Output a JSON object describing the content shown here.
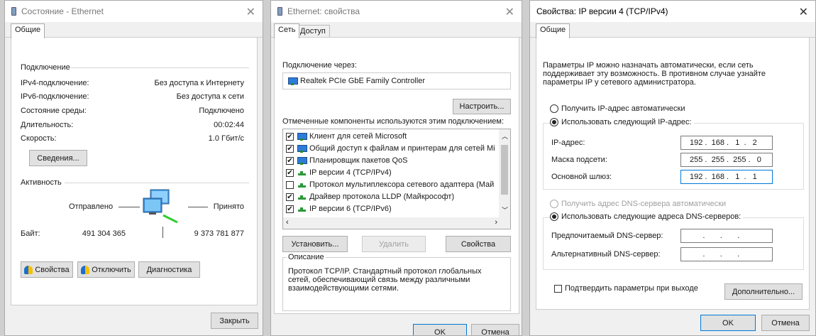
{
  "status": {
    "title": "Состояние - Ethernet",
    "tab_general": "Общие",
    "conn_header": "Подключение",
    "rows": [
      {
        "label": "IPv4-подключение:",
        "value": "Без доступа к Интернету"
      },
      {
        "label": "IPv6-подключение:",
        "value": "Без доступа к сети"
      },
      {
        "label": "Состояние среды:",
        "value": "Подключено"
      },
      {
        "label": "Длительность:",
        "value": "00:02:44"
      },
      {
        "label": "Скорость:",
        "value": "1.0 Гбит/с"
      }
    ],
    "details_button": "Сведения...",
    "activity_header": "Активность",
    "sent_label": "Отправлено",
    "received_label": "Принято",
    "bytes_label": "Байт:",
    "bytes_sent": "491 304 365",
    "bytes_received": "9 373 781 877",
    "properties_button": "Свойства",
    "disable_button": "Отключить",
    "diagnose_button": "Диагностика",
    "close_button": "Закрыть"
  },
  "ethprops": {
    "title": "Ethernet: свойства",
    "tab_network": "Сеть",
    "tab_access": "Доступ",
    "connect_using": "Подключение через:",
    "adapter": "Realtek PCIe GbE Family Controller",
    "configure_button": "Настроить...",
    "components_label": "Отмеченные компоненты используются этим подключением:",
    "components": [
      {
        "checked": "✔",
        "icon": "net",
        "label": "Клиент для сетей Microsoft"
      },
      {
        "checked": "✔",
        "icon": "net",
        "label": "Общий доступ к файлам и принтерам для сетей Mi"
      },
      {
        "checked": "✔",
        "icon": "net",
        "label": "Планировщик пакетов QoS"
      },
      {
        "checked": "✔",
        "icon": "proto",
        "label": "IP версии 4 (TCP/IPv4)"
      },
      {
        "checked": "",
        "icon": "proto",
        "label": "Протокол мультиплексора сетевого адаптера (Май"
      },
      {
        "checked": "✔",
        "icon": "proto",
        "label": "Драйвер протокола LLDP (Майкрософт)"
      },
      {
        "checked": "✔",
        "icon": "proto",
        "label": "IP версии 6 (TCP/IPv6)"
      }
    ],
    "install_button": "Установить...",
    "uninstall_button": "Удалить",
    "properties_button": "Свойства",
    "description_header": "Описание",
    "description": "Протокол TCP/IP. Стандартный протокол глобальных сетей, обеспечивающий связь между различными взаимодействующими сетями.",
    "ok_button": "OK",
    "cancel_button": "Отмена"
  },
  "ipv4": {
    "title": "Свойства: IP версии 4 (TCP/IPv4)",
    "tab_general": "Общие",
    "intro": "Параметры IP можно назначать автоматически, если сеть поддерживает эту возможность. В противном случае узнайте параметры IP у сетевого администратора.",
    "auto_ip": "Получить IP-адрес автоматически",
    "manual_ip": "Использовать следующий IP-адрес:",
    "ip_label": "IP-адрес:",
    "ip_value": "192 .  168 .   1  .   2",
    "mask_label": "Маска подсети:",
    "mask_value": "255 .  255 .  255 .   0",
    "gateway_label": "Основной шлюз:",
    "gateway_value": "192 .  168 .   1  .   1",
    "auto_dns": "Получить адрес DNS-сервера автоматически",
    "manual_dns": "Использовать следующие адреса DNS-серверов:",
    "pref_dns_label": "Предпочитаемый DNS-сервер:",
    "pref_dns_value": "      .       .       .",
    "alt_dns_label": "Альтернативный DNS-сервер:",
    "alt_dns_value": "      .       .       .",
    "validate_label": "Подтвердить параметры при выходе",
    "advanced_button": "Дополнительно...",
    "ok_button": "OK",
    "cancel_button": "Отмена"
  }
}
